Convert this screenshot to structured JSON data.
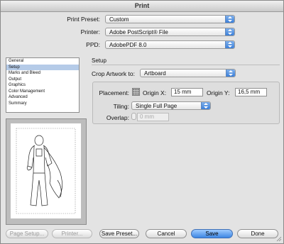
{
  "window": {
    "title": "Print"
  },
  "print_preset": {
    "label": "Print Preset:",
    "value": "Custom"
  },
  "printer": {
    "label": "Printer:",
    "value": "Adobe PostScript® File"
  },
  "ppd": {
    "label": "PPD:",
    "value": "AdobePDF 8.0"
  },
  "sidebar": {
    "items": [
      {
        "label": "General"
      },
      {
        "label": "Setup"
      },
      {
        "label": "Marks and Bleed"
      },
      {
        "label": "Output"
      },
      {
        "label": "Graphics"
      },
      {
        "label": "Color Management"
      },
      {
        "label": "Advanced"
      },
      {
        "label": "Summary"
      }
    ],
    "selected": "Setup"
  },
  "setup": {
    "section_title": "Setup",
    "crop_label": "Crop Artwork to:",
    "crop_value": "Artboard",
    "placement_label": "Placement:",
    "origin_x_label": "Origin X:",
    "origin_x_value": "15 mm",
    "origin_y_label": "Origin Y:",
    "origin_y_value": "16,5 mm",
    "tiling_label": "Tiling:",
    "tiling_value": "Single Full Page",
    "overlap_label": "Overlap:",
    "overlap_value": "0 mm"
  },
  "buttons": {
    "page_setup": "Page Setup...",
    "printer": "Printer...",
    "save_preset": "Save Preset...",
    "cancel": "Cancel",
    "save": "Save",
    "done": "Done"
  },
  "colors": {
    "accent": "#3d86e3",
    "selection": "#b5cbe8"
  }
}
